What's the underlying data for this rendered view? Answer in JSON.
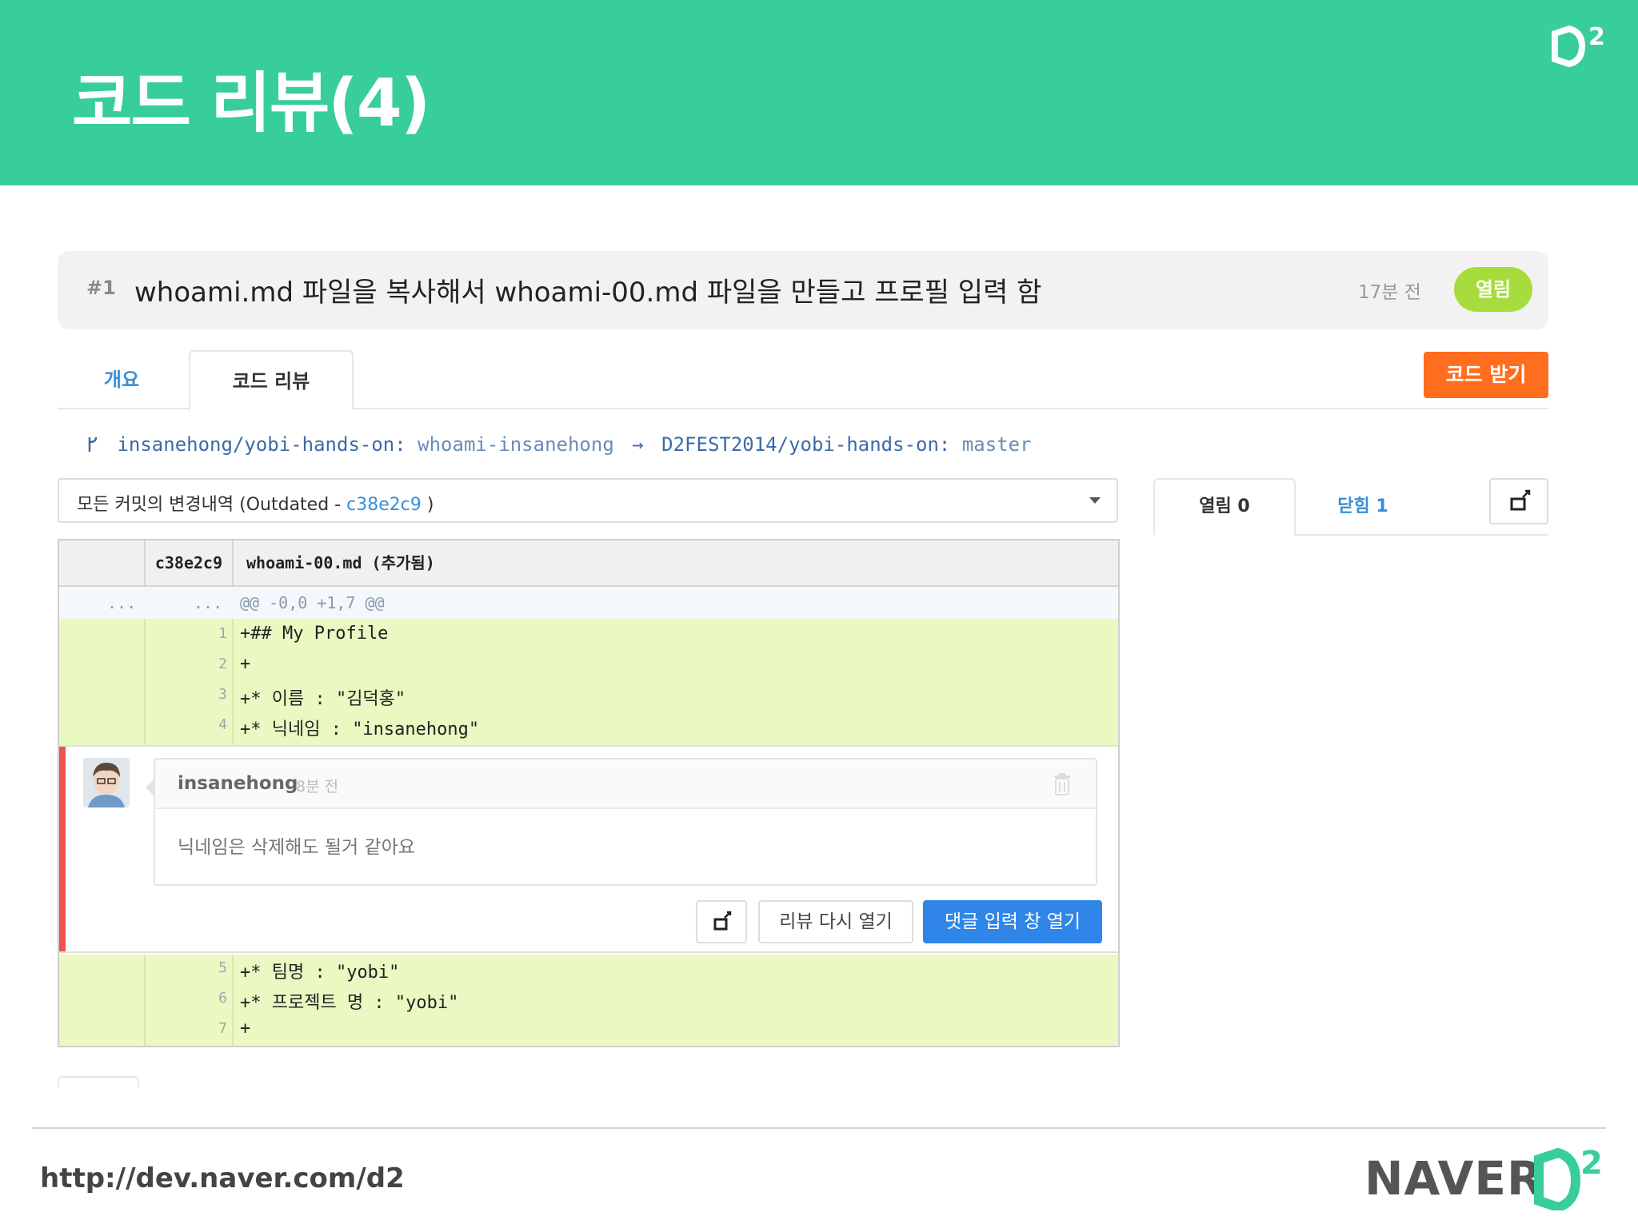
{
  "slide": {
    "title": "코드 리뷰(4)",
    "footer_url": "http://dev.naver.com/d2",
    "footer_brand": "NAVER",
    "brand_logo_text": "D2",
    "colors": {
      "header": "#38cd9c",
      "accent_orange": "#ff6d1f",
      "accent_blue": "#2f86e8",
      "status_green": "#a6dc3c",
      "comment_marker": "#ef5350",
      "added_line_bg": "#eaf8c2"
    }
  },
  "pull_request": {
    "number": "#1",
    "title": "whoami.md 파일을 복사해서 whoami-00.md 파일을 만들고 프로필 입력 함",
    "time": "17분 전",
    "status": "열림"
  },
  "tabs": [
    {
      "label": "개요",
      "active": false
    },
    {
      "label": "코드 리뷰",
      "active": true
    }
  ],
  "get_code_button": "코드 받기",
  "branch": {
    "icon": "branch-icon",
    "source_repo": "insanehong/yobi-hands-on:",
    "source_branch": "whoami-insanehong",
    "arrow": "→",
    "target_repo": "D2FEST2014/yobi-hands-on:",
    "target_branch": "master"
  },
  "commit_select": {
    "prefix": "모든 커밋의 변경내역 (Outdated - ",
    "hash": "c38e2c9",
    "suffix": " )"
  },
  "review_panel": {
    "open_tab": "열림 0",
    "closed_tab": "닫힘 1",
    "expand_icon": "expand-icon"
  },
  "diff": {
    "commit": "c38e2c9",
    "file": "whoami-00.md (추가됨)",
    "hunk": {
      "old_dots": "...",
      "new_dots": "...",
      "header": "@@ -0,0 +1,7 @@"
    },
    "lines_before": [
      {
        "num": "1",
        "code": "+## My Profile"
      },
      {
        "num": "2",
        "code": "+"
      },
      {
        "num": "3",
        "code": "+* 이름 : \"김덕홍\""
      },
      {
        "num": "4",
        "code": "+* 닉네임 : \"insanehong\""
      }
    ],
    "lines_after": [
      {
        "num": "5",
        "code": "+* 팀명 : \"yobi\""
      },
      {
        "num": "6",
        "code": "+* 프로젝트 명 : \"yobi\""
      },
      {
        "num": "7",
        "code": "+"
      }
    ]
  },
  "comment": {
    "author": "insanehong",
    "time": "8분 전",
    "body": "닉네임은 삭제해도 될거 같아요",
    "reopen_button": "리뷰 다시 열기",
    "open_comment_button": "댓글 입력 창 열기"
  }
}
